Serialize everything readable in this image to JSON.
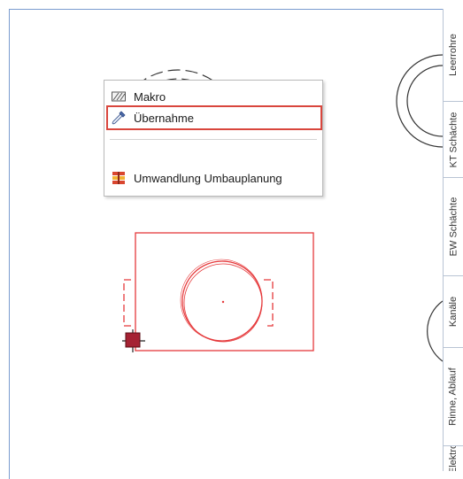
{
  "context_menu": {
    "items": [
      {
        "label": "Makro",
        "icon": "macro-icon"
      },
      {
        "label": "Übernahme",
        "icon": "eyedropper-icon",
        "highlighted": true
      },
      {
        "label": "Umwandlung Umbauplanung",
        "icon": "conversion-icon"
      }
    ]
  },
  "side_tabs": [
    {
      "label": "Leerrohre"
    },
    {
      "label": "KT Schächte"
    },
    {
      "label": "EW Schächte"
    },
    {
      "label": "Kanäle"
    },
    {
      "label": "Rinne, Ablauf"
    },
    {
      "label": "Elektro"
    }
  ],
  "colors": {
    "selection": "#e5393b",
    "cad_line": "#333333",
    "frame": "#7a9ccf",
    "cursor_fill": "#a52233"
  }
}
